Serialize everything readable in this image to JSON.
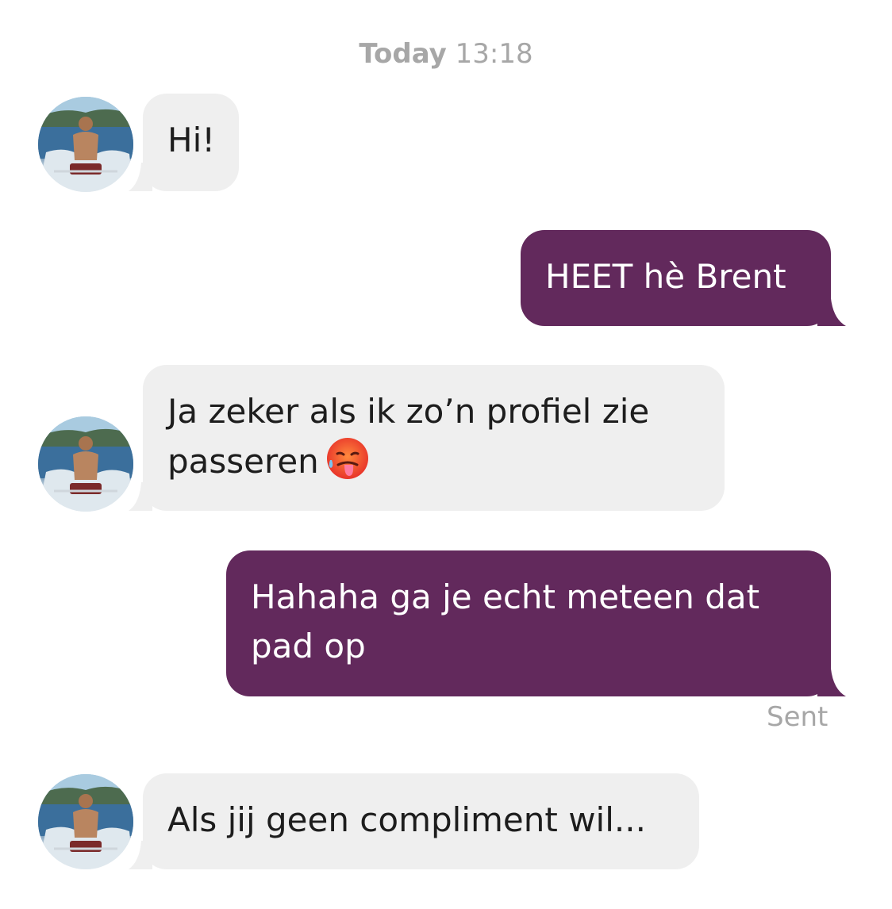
{
  "header": {
    "day_label": "Today",
    "time_label": "13:18"
  },
  "contact": {
    "avatar_icon": "profile-photo-avatar"
  },
  "messages": [
    {
      "direction": "in",
      "line1": "Hi!"
    },
    {
      "direction": "out",
      "line1": "HEET hè Brent"
    },
    {
      "direction": "in",
      "line1": "Ja zeker als ik zo’n profiel zie",
      "line2": "passeren",
      "emoji": "hot-face-emoji"
    },
    {
      "direction": "out",
      "line1": "Hahaha ga je echt meteen dat",
      "line2": "pad op"
    },
    {
      "direction": "in",
      "line1": "Als jij geen compliment wil..."
    }
  ],
  "status": {
    "sent_label": "Sent"
  },
  "colors": {
    "outgoing": "#62295c",
    "incoming": "#efefef",
    "meta_text": "#a7a7a7"
  }
}
